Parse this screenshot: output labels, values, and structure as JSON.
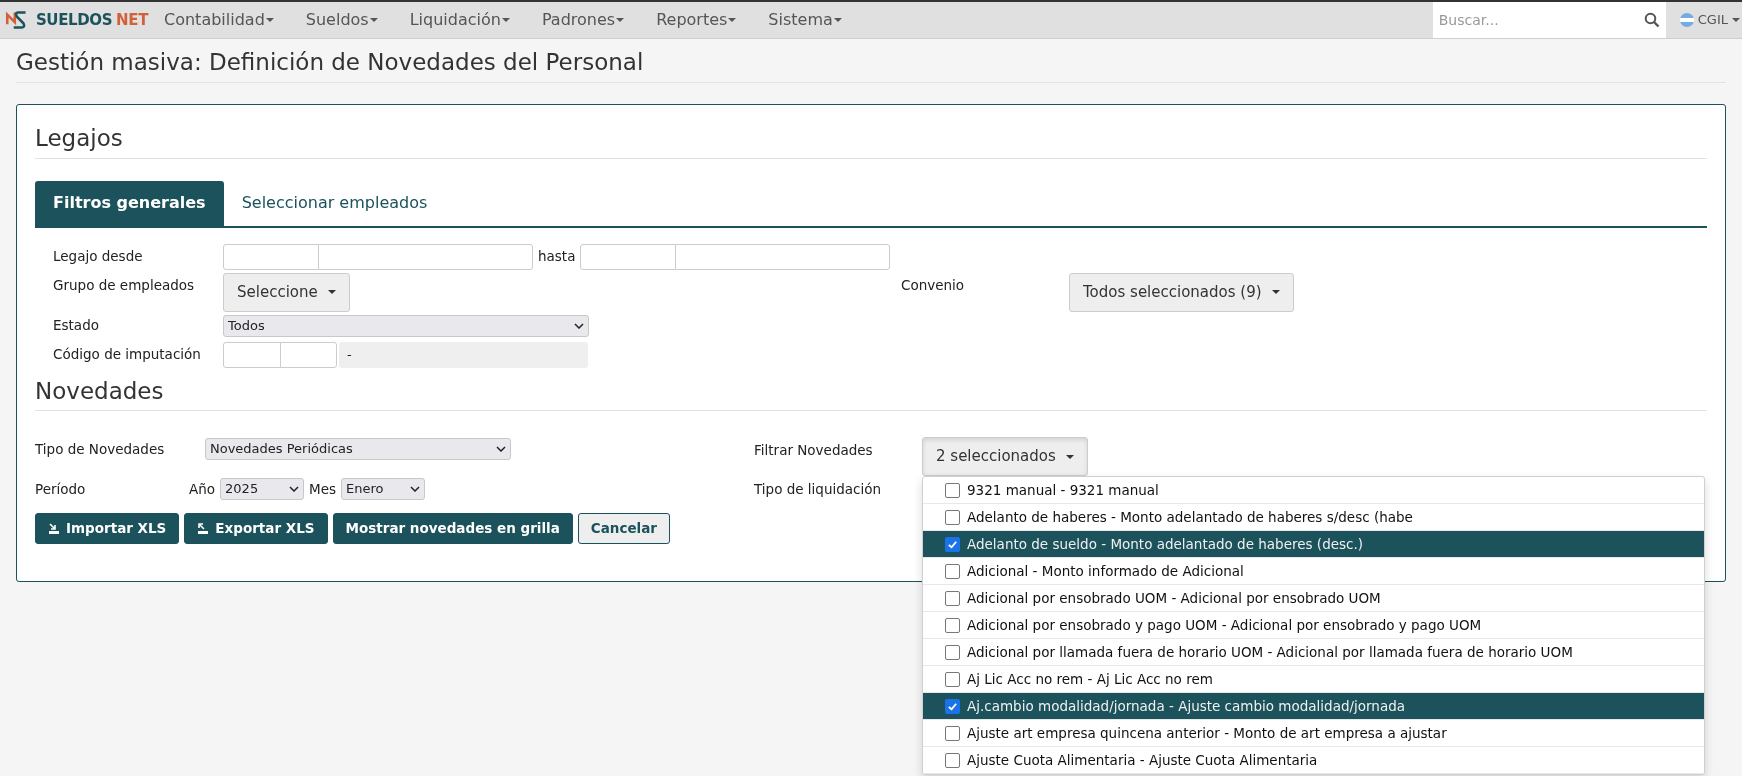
{
  "navbar": {
    "brand": [
      {
        "text": "SUELDOS",
        "color": "#1b525b"
      },
      {
        "text": "NET",
        "color": "#d2603a"
      }
    ],
    "menus": [
      {
        "label": "Contabilidad"
      },
      {
        "label": "Sueldos"
      },
      {
        "label": "Liquidación"
      },
      {
        "label": "Padrones"
      },
      {
        "label": "Reportes"
      },
      {
        "label": "Sistema"
      }
    ],
    "search": {
      "placeholder": "Buscar..."
    },
    "user": "CGIL"
  },
  "page_title": "Gestión masiva: Definición de Novedades del Personal",
  "legajos": {
    "heading": "Legajos",
    "tabs": [
      {
        "label": "Filtros generales",
        "selected": true
      },
      {
        "label": "Seleccionar empleados",
        "selected": false
      }
    ],
    "legajo_desde": {
      "label": "Legajo desde",
      "hasta": "hasta"
    },
    "grupo": {
      "label": "Grupo de empleados",
      "button": "Seleccione"
    },
    "convenio": {
      "label": "Convenio",
      "button": "Todos seleccionados (9)"
    },
    "estado": {
      "label": "Estado",
      "value": "Todos"
    },
    "codigo_imputacion": {
      "label": "Código de imputación",
      "description": "-"
    }
  },
  "novedades": {
    "heading": "Novedades",
    "tipo": {
      "label": "Tipo de Novedades",
      "value": "Novedades Periódicas"
    },
    "periodo": {
      "label": "Período",
      "year_label": "Año",
      "year": "2025",
      "month_label": "Mes",
      "month": "Enero"
    },
    "filtrar": {
      "label": "Filtrar Novedades",
      "button": "2 seleccionados",
      "options": [
        {
          "label": "9321 manual - 9321 manual",
          "checked": false
        },
        {
          "label": "Adelanto de haberes - Monto adelantado de haberes s/desc (habe",
          "checked": false
        },
        {
          "label": "Adelanto de sueldo - Monto adelantado de haberes (desc.)",
          "checked": true
        },
        {
          "label": "Adicional - Monto informado de Adicional",
          "checked": false
        },
        {
          "label": "Adicional por ensobrado UOM - Adicional por ensobrado UOM",
          "checked": false
        },
        {
          "label": "Adicional por ensobrado y pago UOM - Adicional por ensobrado y pago UOM",
          "checked": false
        },
        {
          "label": "Adicional por llamada fuera de horario UOM - Adicional por llamada fuera de horario UOM",
          "checked": false
        },
        {
          "label": "Aj Lic Acc no rem - Aj Lic Acc no rem",
          "checked": false
        },
        {
          "label": "Aj.cambio modalidad/jornada - Ajuste cambio modalidad/jornada",
          "checked": true
        },
        {
          "label": "Ajuste art empresa quincena anterior - Monto de art empresa a ajustar",
          "checked": false
        },
        {
          "label": "Ajuste Cuota Alimentaria - Ajuste Cuota Alimentaria",
          "checked": false
        }
      ]
    },
    "tipo_liquidacion": {
      "label": "Tipo de liquidación"
    },
    "buttons": [
      {
        "label": "Importar XLS",
        "kind": "import"
      },
      {
        "label": "Exportar XLS",
        "kind": "export"
      },
      {
        "label": "Mostrar novedades en grilla",
        "kind": "primary"
      },
      {
        "label": "Cancelar",
        "kind": "secondary"
      }
    ]
  }
}
